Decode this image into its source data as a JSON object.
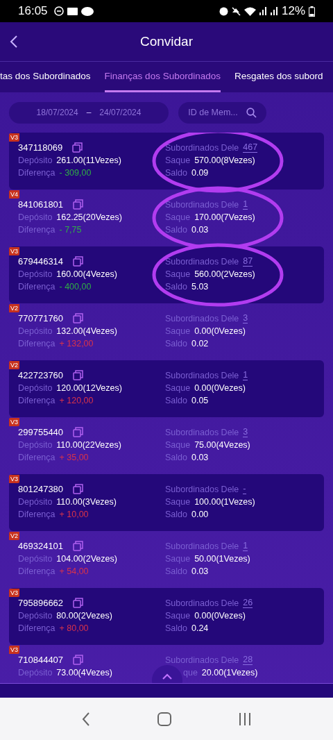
{
  "status_bar": {
    "time": "16:05",
    "battery": "12%"
  },
  "header": {
    "title": "Convidar"
  },
  "tabs": [
    {
      "label": "tas dos Subordinados",
      "selected": false
    },
    {
      "label": "Finanças dos Subordinados",
      "selected": true
    },
    {
      "label": "Resgates dos subord",
      "selected": false
    }
  ],
  "filter": {
    "date_from": "18/07/2024",
    "separator": "–",
    "date_to": "24/07/2024",
    "search_placeholder": "ID de Mem..."
  },
  "rows": [
    {
      "level": "V3",
      "id": "347118069",
      "deposit": {
        "label": "Depósito",
        "value": "261.00(11Vezes)"
      },
      "difference": {
        "label": "Diferença",
        "text": "- 309,00",
        "color": "#2fae45"
      },
      "subordinates": {
        "label": "Subordinados Dele",
        "value": "467"
      },
      "withdrawal": {
        "label": "Saque",
        "value": "570.00(8Vezes)"
      },
      "balance": {
        "label": "Saldo",
        "value": "0.09"
      },
      "circled": true
    },
    {
      "level": "V4",
      "id": "841061801",
      "deposit": {
        "label": "Depósito",
        "value": "162.25(20Vezes)"
      },
      "difference": {
        "label": "Diferença",
        "text": "- 7,75",
        "color": "#2fae45"
      },
      "subordinates": {
        "label": "Subordinados Dele",
        "value": "1"
      },
      "withdrawal": {
        "label": "Saque",
        "value": "170.00(7Vezes)"
      },
      "balance": {
        "label": "Saldo",
        "value": "0.03"
      },
      "circled": true
    },
    {
      "level": "V3",
      "id": "679446314",
      "deposit": {
        "label": "Depósito",
        "value": "160.00(4Vezes)"
      },
      "difference": {
        "label": "Diferença",
        "text": "- 400,00",
        "color": "#2fae45"
      },
      "subordinates": {
        "label": "Subordinados Dele",
        "value": "87"
      },
      "withdrawal": {
        "label": "Saque",
        "value": "560.00(2Vezes)"
      },
      "balance": {
        "label": "Saldo",
        "value": "5.03"
      },
      "circled": true
    },
    {
      "level": "V2",
      "id": "770771760",
      "deposit": {
        "label": "Depósito",
        "value": "132.00(4Vezes)"
      },
      "difference": {
        "label": "Diferença",
        "text": "+ 132,00",
        "color": "#d8324a"
      },
      "subordinates": {
        "label": "Subordinados Dele",
        "value": "3"
      },
      "withdrawal": {
        "label": "Saque",
        "value": "0.00(0Vezes)"
      },
      "balance": {
        "label": "Saldo",
        "value": "0.02"
      },
      "circled": false
    },
    {
      "level": "V2",
      "id": "422723760",
      "deposit": {
        "label": "Depósito",
        "value": "120.00(12Vezes)"
      },
      "difference": {
        "label": "Diferença",
        "text": "+ 120,00",
        "color": "#d8324a"
      },
      "subordinates": {
        "label": "Subordinados Dele",
        "value": "1"
      },
      "withdrawal": {
        "label": "Saque",
        "value": "0.00(0Vezes)"
      },
      "balance": {
        "label": "Saldo",
        "value": "0.05"
      },
      "circled": false
    },
    {
      "level": "V3",
      "id": "299755440",
      "deposit": {
        "label": "Depósito",
        "value": "110.00(22Vezes)"
      },
      "difference": {
        "label": "Diferença",
        "text": "+ 35,00",
        "color": "#d8324a"
      },
      "subordinates": {
        "label": "Subordinados Dele",
        "value": "3"
      },
      "withdrawal": {
        "label": "Saque",
        "value": "75.00(4Vezes)"
      },
      "balance": {
        "label": "Saldo",
        "value": "0.03"
      },
      "circled": false
    },
    {
      "level": "V3",
      "id": "801247380",
      "deposit": {
        "label": "Depósito",
        "value": "110.00(3Vezes)"
      },
      "difference": {
        "label": "Diferença",
        "text": "+ 10,00",
        "color": "#d8324a"
      },
      "subordinates": {
        "label": "Subordinados Dele",
        "value": "-"
      },
      "withdrawal": {
        "label": "Saque",
        "value": "100.00(1Vezes)"
      },
      "balance": {
        "label": "Saldo",
        "value": "0.00"
      },
      "circled": false
    },
    {
      "level": "V2",
      "id": "469324101",
      "deposit": {
        "label": "Depósito",
        "value": "104.00(2Vezes)"
      },
      "difference": {
        "label": "Diferença",
        "text": "+ 54,00",
        "color": "#d8324a"
      },
      "subordinates": {
        "label": "Subordinados Dele",
        "value": "1"
      },
      "withdrawal": {
        "label": "Saque",
        "value": "50.00(1Vezes)"
      },
      "balance": {
        "label": "Saldo",
        "value": "0.03"
      },
      "circled": false
    },
    {
      "level": "V3",
      "id": "795896662",
      "deposit": {
        "label": "Depósito",
        "value": "80.00(2Vezes)"
      },
      "difference": {
        "label": "Diferença",
        "text": "+ 80,00",
        "color": "#d8324a"
      },
      "subordinates": {
        "label": "Subordinados Dele",
        "value": "26"
      },
      "withdrawal": {
        "label": "Saque",
        "value": "0.00(0Vezes)"
      },
      "balance": {
        "label": "Saldo",
        "value": "0.24"
      },
      "circled": false
    },
    {
      "level": "V3",
      "id": "710844407",
      "deposit": {
        "label": "Depósito",
        "value": "73.00(4Vezes)"
      },
      "subordinates": {
        "label": "Subordinados Dele",
        "value": "28"
      },
      "withdrawal": {
        "label": "que",
        "value": "20.00(1Vezes)"
      },
      "circled": false
    }
  ]
}
